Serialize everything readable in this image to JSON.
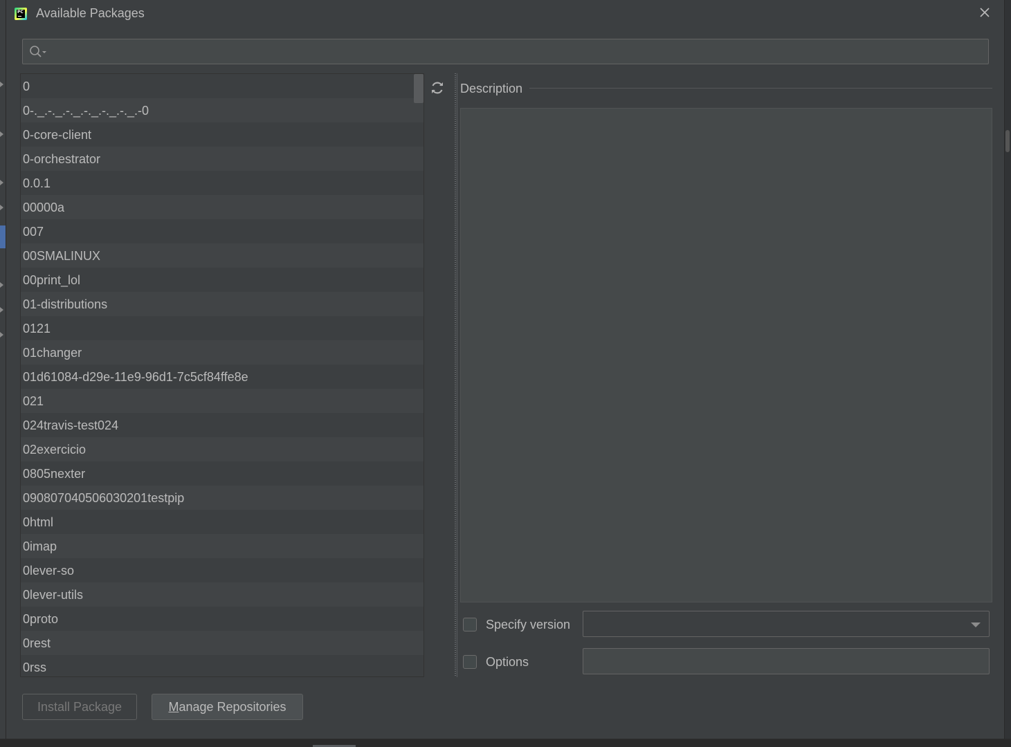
{
  "window": {
    "title": "Available Packages",
    "app_icon": "pycharm-app-icon",
    "app_icon_text": "PC"
  },
  "search": {
    "value": "",
    "placeholder": "",
    "icon": "search-icon"
  },
  "packages": [
    "0",
    "0-._.-._.-._.-._.-._.-._.-0",
    "0-core-client",
    "0-orchestrator",
    "0.0.1",
    "00000a",
    "007",
    "00SMALINUX",
    "00print_lol",
    "01-distributions",
    "0121",
    "01changer",
    "01d61084-d29e-11e9-96d1-7c5cf84ffe8e",
    "021",
    "024travis-test024",
    "02exercicio",
    "0805nexter",
    "090807040506030201testpip",
    "0html",
    "0imap",
    "0lever-so",
    "0lever-utils",
    "0proto",
    "0rest",
    "0rss"
  ],
  "description": {
    "label": "Description",
    "content": ""
  },
  "specify_version": {
    "label": "Specify version",
    "checked": false,
    "selected": ""
  },
  "options": {
    "label": "Options",
    "checked": false,
    "value": ""
  },
  "buttons": {
    "install": "Install Package",
    "manage_mnemonic": "M",
    "manage_rest": "anage Repositories"
  },
  "colors": {
    "background": "#3c3f41",
    "row_alt": "#414446",
    "text": "#bbbbbb",
    "disabled_text": "#787878",
    "field_bg": "#45494a",
    "border": "#646464"
  }
}
